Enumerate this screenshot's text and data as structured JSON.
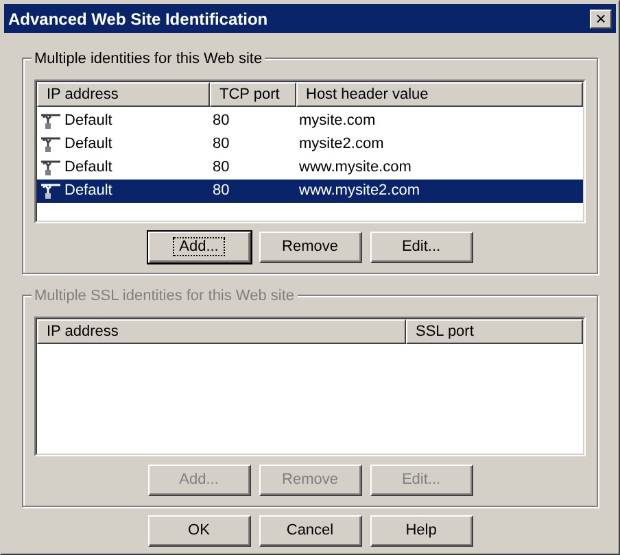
{
  "window": {
    "title": "Advanced Web Site Identification",
    "close": "×"
  },
  "identities": {
    "title": "Multiple identities for this Web site",
    "disabled": false,
    "columns": [
      "IP address",
      "TCP port",
      "Host header value"
    ],
    "rows": [
      {
        "cells": [
          "Default",
          "80",
          "mysite.com"
        ],
        "selected": false
      },
      {
        "cells": [
          "Default",
          "80",
          "mysite2.com"
        ],
        "selected": false
      },
      {
        "cells": [
          "Default",
          "80",
          "www.mysite.com"
        ],
        "selected": false
      },
      {
        "cells": [
          "Default",
          "80",
          "www.mysite2.com"
        ],
        "selected": true
      }
    ],
    "buttons": [
      {
        "label": "Add...",
        "focused": true
      },
      {
        "label": "Remove",
        "focused": false
      },
      {
        "label": "Edit...",
        "focused": false
      }
    ]
  },
  "ssl": {
    "title": "Multiple SSL identities for this Web site",
    "disabled": true,
    "columns": [
      "IP address",
      "SSL port"
    ],
    "buttons": [
      {
        "label": "Add...",
        "focused": false
      },
      {
        "label": "Remove",
        "focused": false
      },
      {
        "label": "Edit...",
        "focused": false
      }
    ]
  },
  "buttons": [
    {
      "label": "OK"
    },
    {
      "label": "Cancel"
    },
    {
      "label": "Help"
    }
  ]
}
